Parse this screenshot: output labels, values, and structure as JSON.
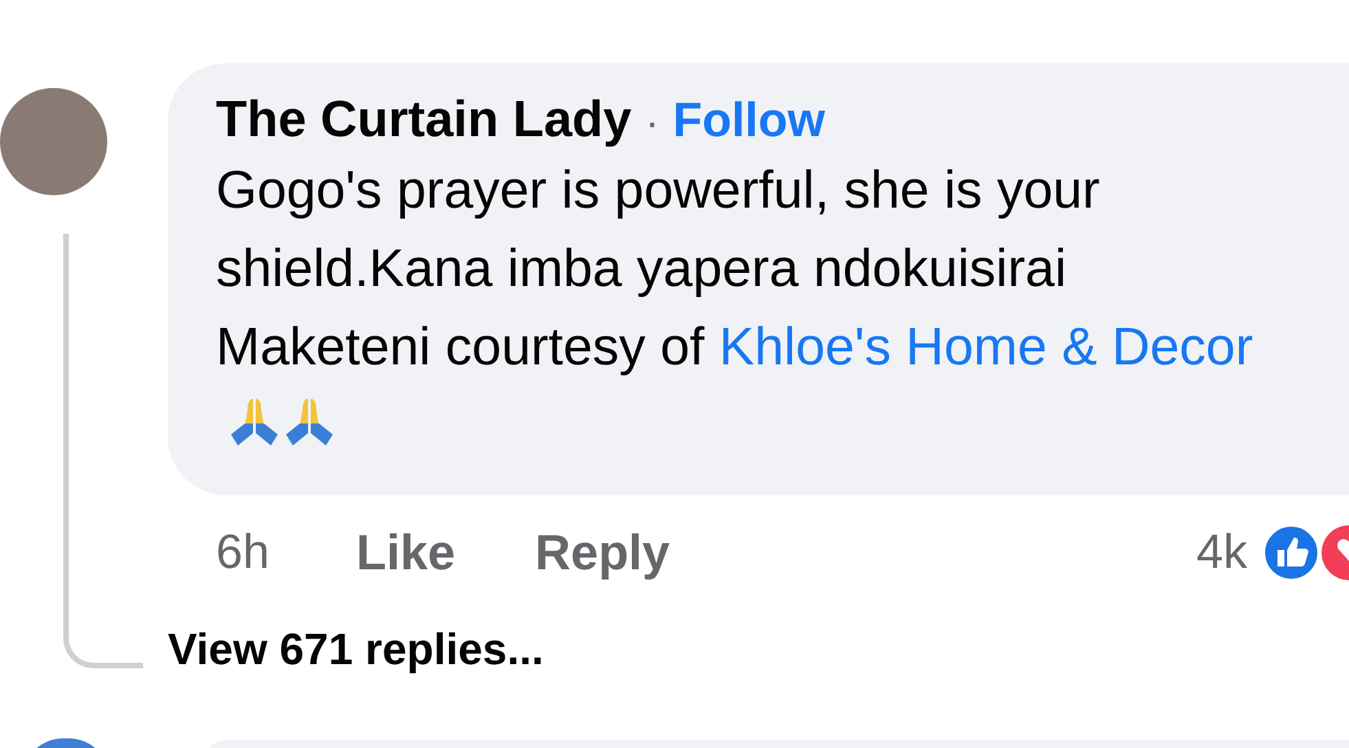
{
  "comment": {
    "author": "The Curtain Lady",
    "separator": "·",
    "follow": "Follow",
    "text": "Gogo's prayer is powerful, she is your shield.Kana imba yapera ndokuisirai Maketeni courtesy of ",
    "link": "Khloe's Home & Decor",
    "time": "6h",
    "actions": [
      "Like",
      "Reply"
    ],
    "reaction_count": "4k"
  },
  "view_replies": "View 671 replies..."
}
